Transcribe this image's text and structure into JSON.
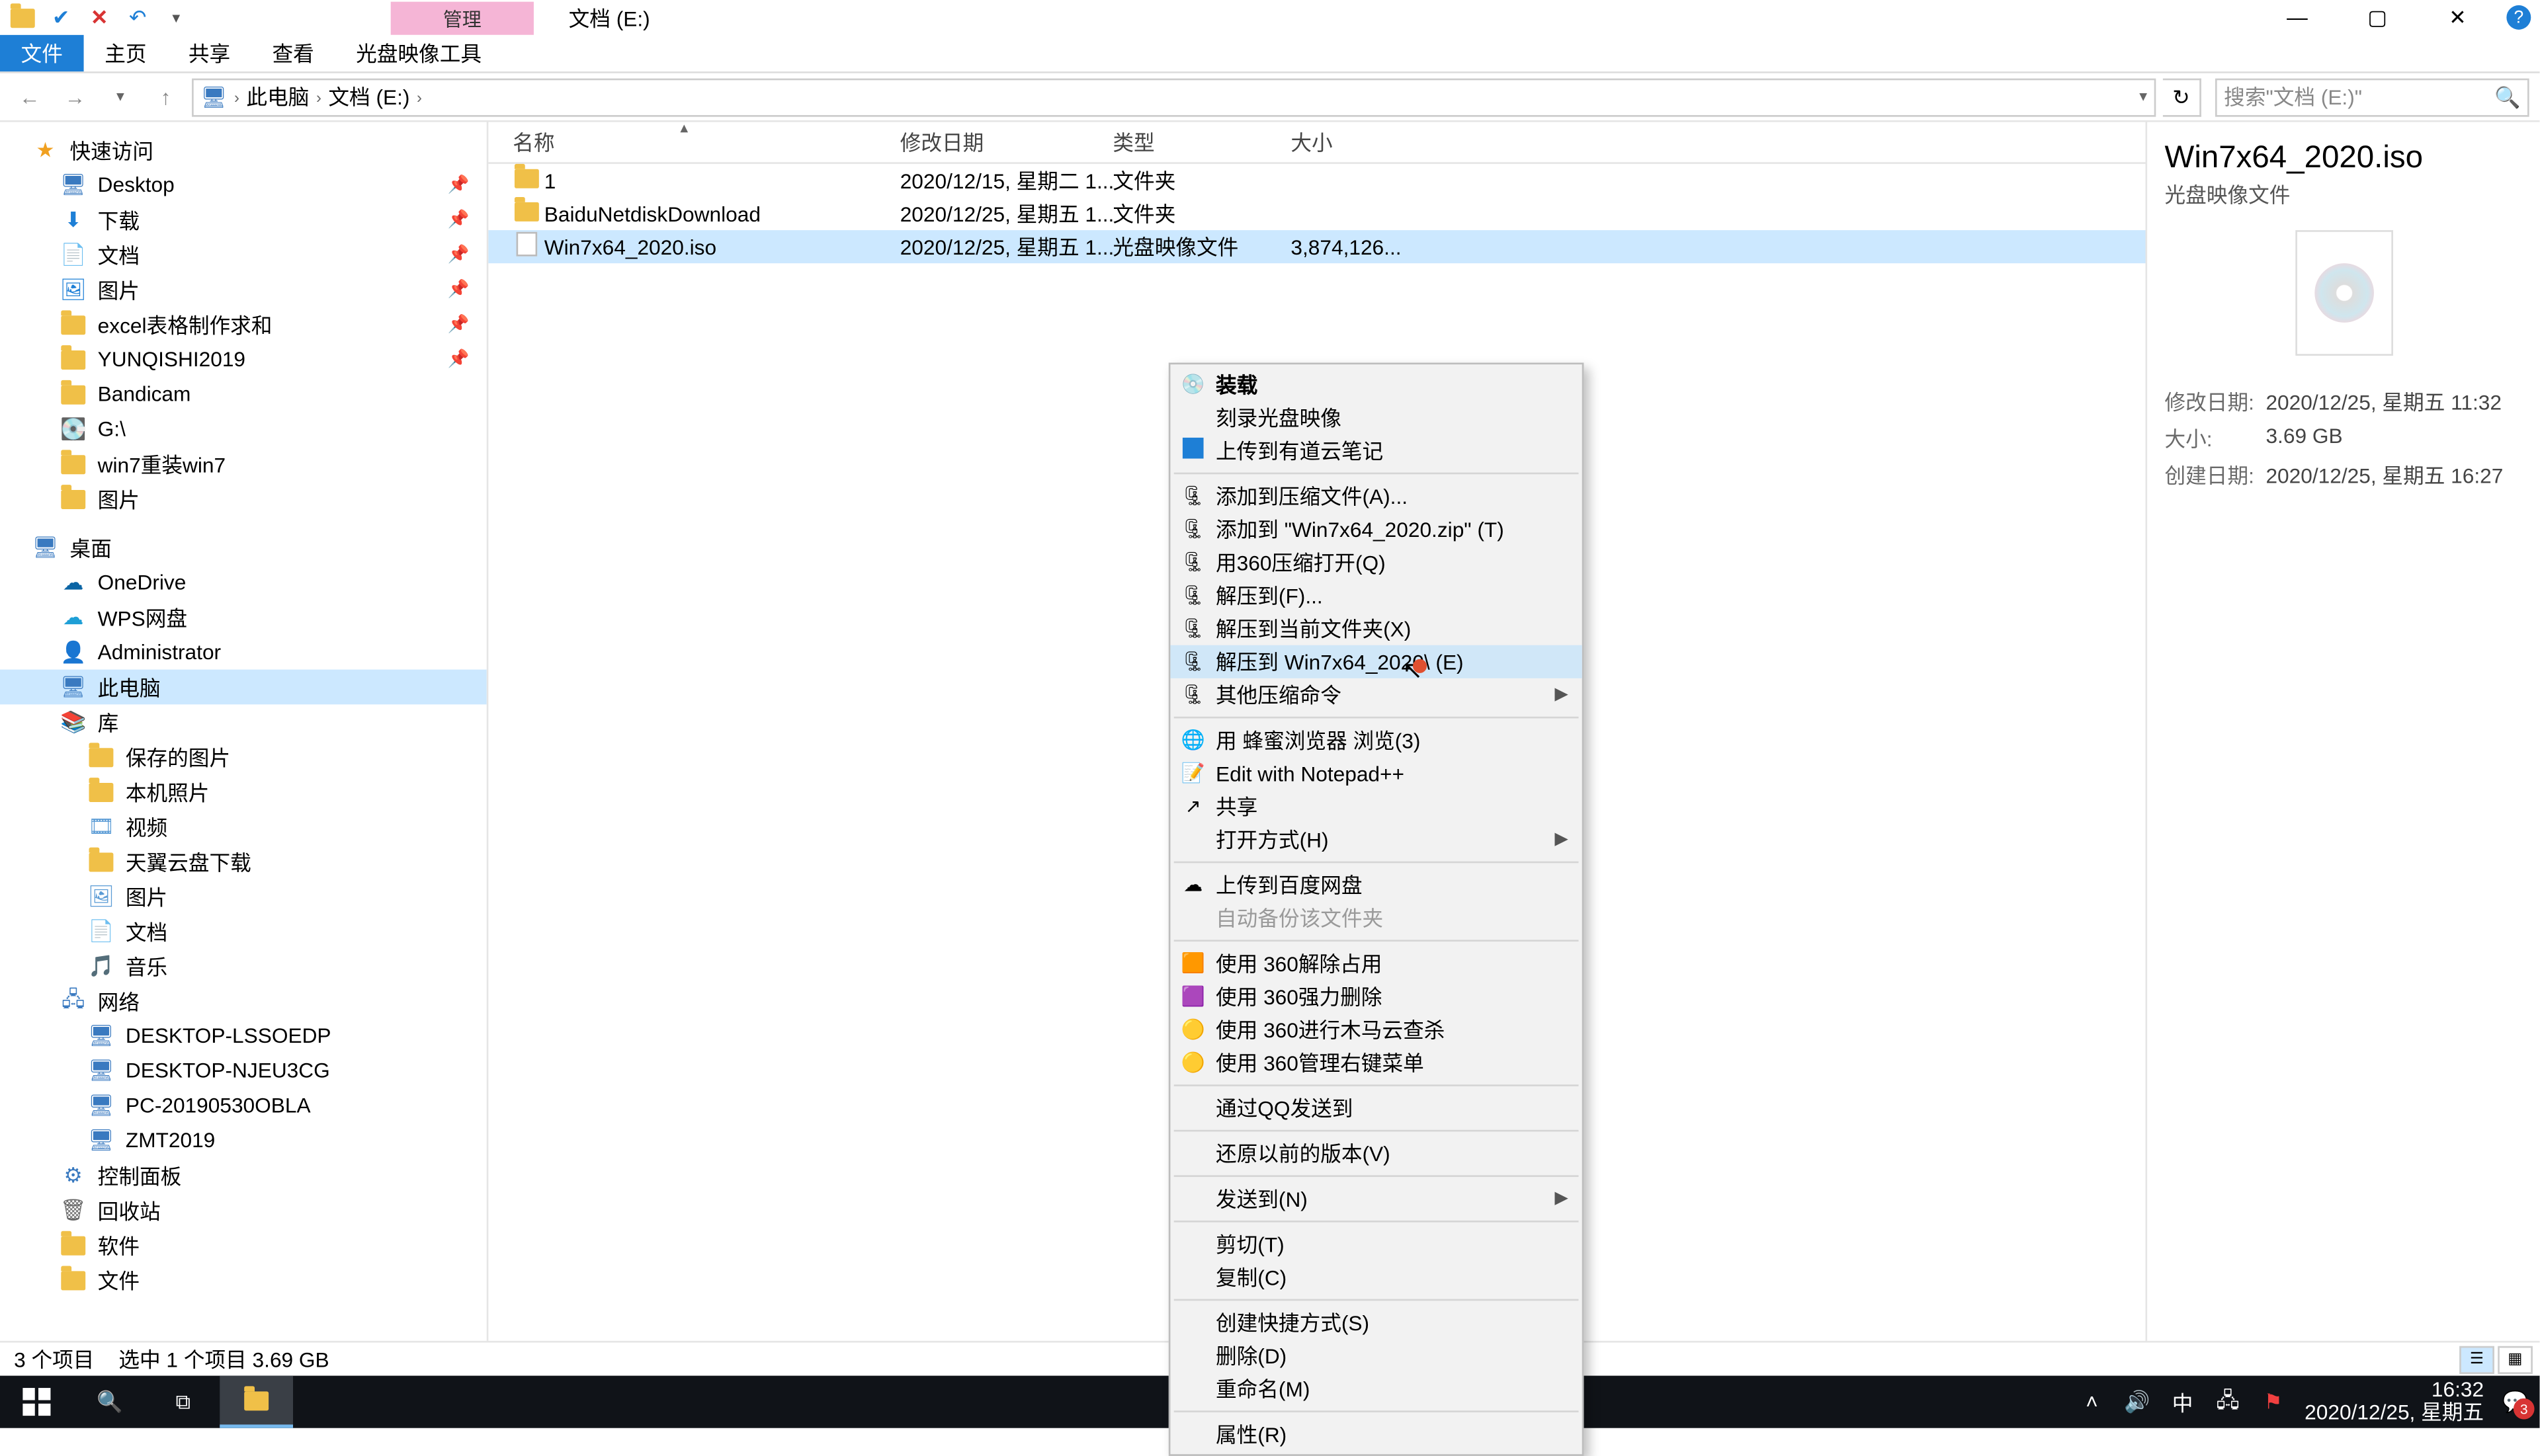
{
  "title_context_tab": "管理",
  "title_texts": {
    "path_label": "文档 (E:)"
  },
  "ribbon": {
    "file": "文件",
    "home": "主页",
    "share": "共享",
    "view": "查看",
    "disc_tools": "光盘映像工具"
  },
  "win": {
    "min": "—",
    "max": "▢",
    "close": "✕"
  },
  "address": {
    "crumbs": [
      "此电脑",
      "文档 (E:)"
    ],
    "search_placeholder": "搜索\"文档 (E:)\""
  },
  "tree": {
    "quick": "快速访问",
    "desktop": "Desktop",
    "downloads": "下载",
    "documents": "文档",
    "pictures": "图片",
    "excel": "excel表格制作求和",
    "yunqishi": "YUNQISHI2019",
    "bandicam": "Bandicam",
    "gdrive": "G:\\",
    "win7": "win7重装win7",
    "pictures2": "图片",
    "desktop_group": "桌面",
    "onedrive": "OneDrive",
    "wps": "WPS网盘",
    "admin": "Administrator",
    "thispc": "此电脑",
    "library": "库",
    "saved_pics": "保存的图片",
    "local_pics": "本机照片",
    "videos": "视频",
    "tianyi": "天翼云盘下载",
    "pics_lib": "图片",
    "docs_lib": "文档",
    "music": "音乐",
    "network": "网络",
    "pc1": "DESKTOP-LSSOEDP",
    "pc2": "DESKTOP-NJEU3CG",
    "pc3": "PC-20190530OBLA",
    "pc4": "ZMT2019",
    "ctrl_panel": "控制面板",
    "recycle": "回收站",
    "software": "软件",
    "files": "文件"
  },
  "columns": {
    "name": "名称",
    "date": "修改日期",
    "type": "类型",
    "size": "大小"
  },
  "files": [
    {
      "name": "1",
      "date": "2020/12/15, 星期二 1...",
      "type": "文件夹",
      "size": "",
      "icon": "folder"
    },
    {
      "name": "BaiduNetdiskDownload",
      "date": "2020/12/25, 星期五 1...",
      "type": "文件夹",
      "size": "",
      "icon": "folder"
    },
    {
      "name": "Win7x64_2020.iso",
      "date": "2020/12/25, 星期五 1...",
      "type": "光盘映像文件",
      "size": "3,874,126...",
      "icon": "iso",
      "selected": true
    }
  ],
  "details": {
    "title": "Win7x64_2020.iso",
    "subtitle": "光盘映像文件",
    "props": [
      {
        "k": "修改日期:",
        "v": "2020/12/25, 星期五 11:32"
      },
      {
        "k": "大小:",
        "v": "3.69 GB"
      },
      {
        "k": "创建日期:",
        "v": "2020/12/25, 星期五 16:27"
      }
    ]
  },
  "context_menu": [
    {
      "label": "装载",
      "icon": "disc",
      "bold": true
    },
    {
      "label": "刻录光盘映像"
    },
    {
      "label": "上传到有道云笔记",
      "icon": "blue"
    },
    {
      "sep": true
    },
    {
      "label": "添加到压缩文件(A)...",
      "icon": "arch"
    },
    {
      "label": "添加到 \"Win7x64_2020.zip\" (T)",
      "icon": "arch"
    },
    {
      "label": "用360压缩打开(Q)",
      "icon": "arch"
    },
    {
      "label": "解压到(F)...",
      "icon": "arch"
    },
    {
      "label": "解压到当前文件夹(X)",
      "icon": "arch"
    },
    {
      "label": "解压到 Win7x64_2020\\ (E)",
      "icon": "arch",
      "hl": true
    },
    {
      "label": "其他压缩命令",
      "icon": "arch",
      "arrow": true
    },
    {
      "sep": true
    },
    {
      "label": "用 蜂蜜浏览器 浏览(3)",
      "icon": "green"
    },
    {
      "label": "Edit with Notepad++",
      "icon": "npp"
    },
    {
      "label": "共享",
      "icon": "share"
    },
    {
      "label": "打开方式(H)",
      "arrow": true
    },
    {
      "sep": true
    },
    {
      "label": "上传到百度网盘",
      "icon": "baidu"
    },
    {
      "label": "自动备份该文件夹",
      "disabled": true
    },
    {
      "sep": true
    },
    {
      "label": "使用 360解除占用",
      "icon": "360o"
    },
    {
      "label": "使用 360强力删除",
      "icon": "360p"
    },
    {
      "label": "使用 360进行木马云查杀",
      "icon": "360y"
    },
    {
      "label": "使用 360管理右键菜单",
      "icon": "360y"
    },
    {
      "sep": true
    },
    {
      "label": "通过QQ发送到"
    },
    {
      "sep": true
    },
    {
      "label": "还原以前的版本(V)"
    },
    {
      "sep": true
    },
    {
      "label": "发送到(N)",
      "arrow": true
    },
    {
      "sep": true
    },
    {
      "label": "剪切(T)"
    },
    {
      "label": "复制(C)"
    },
    {
      "sep": true
    },
    {
      "label": "创建快捷方式(S)"
    },
    {
      "label": "删除(D)"
    },
    {
      "label": "重命名(M)"
    },
    {
      "sep": true
    },
    {
      "label": "属性(R)"
    }
  ],
  "status": {
    "count": "3 个项目",
    "selection": "选中 1 个项目  3.69 GB"
  },
  "taskbar": {
    "clock_time": "16:32",
    "clock_date": "2020/12/25, 星期五",
    "ime": "中",
    "notif_count": "3"
  }
}
